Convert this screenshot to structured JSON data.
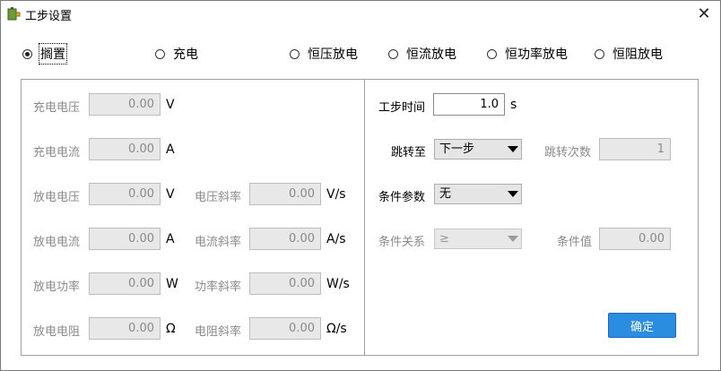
{
  "window": {
    "title": "工步设置",
    "close_symbol": "✕"
  },
  "modes": [
    {
      "label": "搁置",
      "checked": true
    },
    {
      "label": "充电",
      "checked": false
    },
    {
      "label": "恒压放电",
      "checked": false
    },
    {
      "label": "恒流放电",
      "checked": false
    },
    {
      "label": "恒功率放电",
      "checked": false
    },
    {
      "label": "恒阻放电",
      "checked": false
    }
  ],
  "left": {
    "charge_voltage": {
      "label": "充电电压",
      "value": "0.00",
      "unit": "V"
    },
    "charge_current": {
      "label": "充电电流",
      "value": "0.00",
      "unit": "A"
    },
    "discharge_voltage": {
      "label": "放电电压",
      "value": "0.00",
      "unit": "V"
    },
    "discharge_current": {
      "label": "放电电流",
      "value": "0.00",
      "unit": "A"
    },
    "discharge_power": {
      "label": "放电功率",
      "value": "0.00",
      "unit": "W"
    },
    "discharge_resistance": {
      "label": "放电电阻",
      "value": "0.00",
      "unit": "Ω"
    },
    "voltage_slope": {
      "label": "电压斜率",
      "value": "0.00",
      "unit": "V/s"
    },
    "current_slope": {
      "label": "电流斜率",
      "value": "0.00",
      "unit": "A/s"
    },
    "power_slope": {
      "label": "功率斜率",
      "value": "0.00",
      "unit": "W/s"
    },
    "resistance_slope": {
      "label": "电阻斜率",
      "value": "0.00",
      "unit": "Ω/s"
    }
  },
  "right": {
    "step_time": {
      "label": "工步时间",
      "value": "1.0",
      "unit": "s"
    },
    "jump_to": {
      "label": "跳转至",
      "value": "下一步"
    },
    "jump_count": {
      "label": "跳转次数",
      "value": "1"
    },
    "condition_param": {
      "label": "条件参数",
      "value": "无"
    },
    "condition_relation": {
      "label": "条件关系",
      "value": "≥"
    },
    "condition_value": {
      "label": "条件值",
      "value": "0.00"
    },
    "ok_label": "确定"
  }
}
